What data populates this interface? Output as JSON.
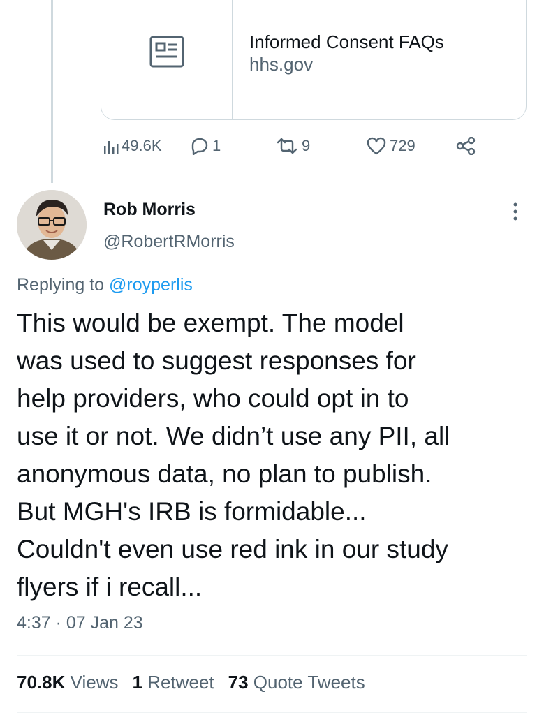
{
  "quoted_card": {
    "title": "Informed Consent FAQs",
    "domain": "hhs.gov",
    "icon": "newspaper-icon"
  },
  "parent_actions": {
    "views": "49.6K",
    "replies": "1",
    "retweets": "9",
    "likes": "729"
  },
  "tweet": {
    "author_name": "Rob Morris",
    "author_handle": "@RobertRMorris",
    "replying_prefix": "Replying to",
    "replying_to": "@royperlis",
    "text": "This would be exempt. The model\nwas used to suggest responses for\nhelp providers, who could opt in to\nuse it or not. We didn’t use any PII, all\nanonymous data, no plan to publish.\nBut MGH's IRB is formidable...\nCouldn't even use red ink in our study\nflyers if i recall...",
    "timestamp": "4:37 · 07 Jan 23"
  },
  "stats": {
    "views_count": "70.8K",
    "views_label": "Views",
    "retweets_count": "1",
    "retweets_label": "Retweet",
    "quotes_count": "73",
    "quotes_label": "Quote Tweets"
  },
  "colors": {
    "text": "#0f1419",
    "secondary": "#536471",
    "link": "#1d9bf0",
    "border": "#cfd9de"
  }
}
